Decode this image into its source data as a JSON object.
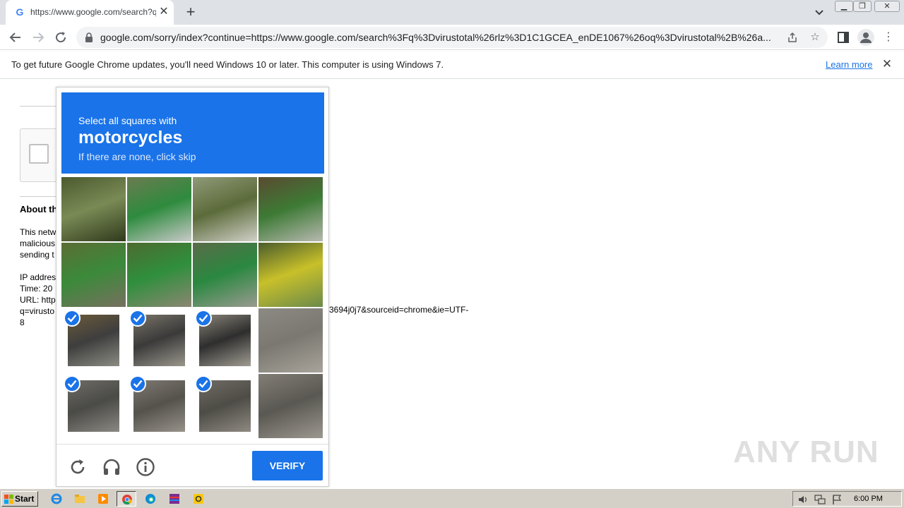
{
  "browser": {
    "tab": {
      "title": "https://www.google.com/search?q=",
      "favicon": "google-g-icon"
    },
    "url": "google.com/sorry/index?continue=https://www.google.com/search%3Fq%3Dvirustotal%26rlz%3D1C1GCEA_enDE1067%26oq%3Dvirustotal%2B%26a...",
    "icons": [
      "back-icon",
      "forward-icon",
      "reload-icon",
      "lock-icon",
      "share-icon",
      "star-icon",
      "side-panel-icon",
      "profile-icon",
      "menu-icon"
    ]
  },
  "infobar": {
    "message": "To get future Google Chrome updates, you'll need Windows 10 or later. This computer is using Windows 7.",
    "link": "Learn more"
  },
  "page": {
    "heading": "About th",
    "lines": [
      "This netw",
      "malicious",
      "sending t",
      "",
      "IP addres",
      "Time: 20",
      "URL: http",
      "q=virusto",
      "8"
    ],
    "url_tail": "3694j0j7&sourceid=chrome&ie=UTF-"
  },
  "challenge": {
    "instruction": "Select all squares with",
    "target": "motorcycles",
    "hint": "If there are none, click skip",
    "selected_tiles": [
      8,
      9,
      10,
      12,
      13,
      14
    ],
    "verify_label": "VERIFY",
    "footer_icons": [
      "reload-challenge-icon",
      "audio-challenge-icon",
      "info-icon"
    ]
  },
  "watermark": {
    "text": "ANY RUN"
  },
  "taskbar": {
    "start_label": "Start",
    "apps": [
      "internet-explorer-icon",
      "file-explorer-icon",
      "media-player-icon",
      "chrome-icon",
      "edge-icon",
      "winrar-icon",
      "norton-icon"
    ],
    "active_app": "chrome-icon",
    "tray_icons": [
      "volume-icon",
      "network-icon",
      "flag-icon"
    ],
    "clock": "6:00 PM"
  },
  "colors": {
    "accent": "#1a73e8",
    "tabstrip": "#dee1e6",
    "taskbar": "#d4d0c8"
  }
}
